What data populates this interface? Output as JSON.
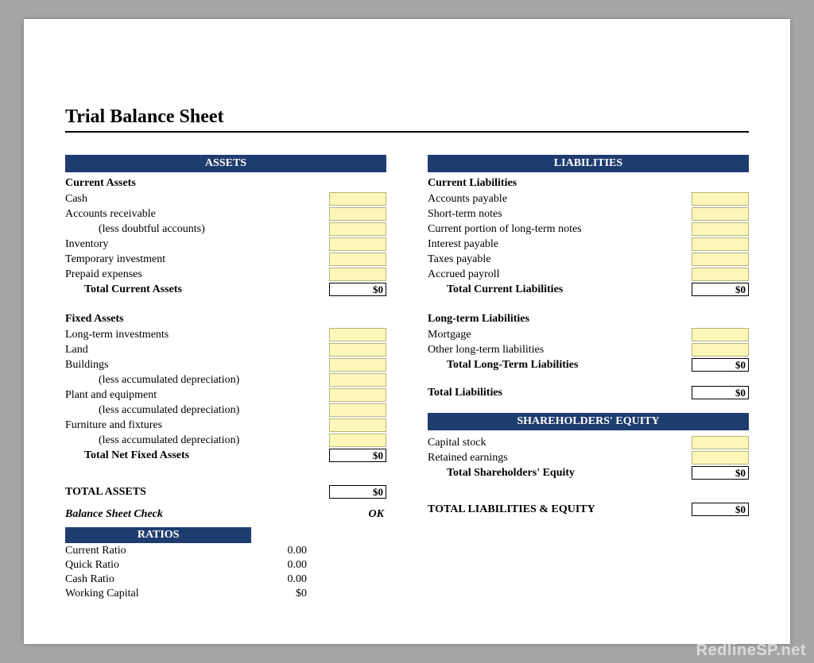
{
  "title": "Trial Balance Sheet",
  "watermark": "RedlineSP.net",
  "bands": {
    "assets": "ASSETS",
    "liabilities": "LIABILITIES",
    "equity": "SHAREHOLDERS' EQUITY",
    "ratios": "RATIOS"
  },
  "assets": {
    "current": {
      "heading": "Current Assets",
      "items": [
        {
          "label": "Cash"
        },
        {
          "label": "Accounts receivable"
        },
        {
          "label": "(less doubtful accounts)",
          "indent": true
        },
        {
          "label": "Inventory"
        },
        {
          "label": "Temporary investment"
        },
        {
          "label": "Prepaid expenses"
        }
      ],
      "total_label": "Total Current Assets",
      "total_value": "$0"
    },
    "fixed": {
      "heading": "Fixed Assets",
      "items": [
        {
          "label": "Long-term investments"
        },
        {
          "label": "Land"
        },
        {
          "label": "Buildings"
        },
        {
          "label": "(less accumulated depreciation)",
          "indent": true
        },
        {
          "label": "Plant and equipment"
        },
        {
          "label": "(less accumulated depreciation)",
          "indent": true
        },
        {
          "label": "Furniture and fixtures"
        },
        {
          "label": "(less accumulated depreciation)",
          "indent": true
        }
      ],
      "total_label": "Total Net Fixed Assets",
      "total_value": "$0"
    },
    "grand_label": "TOTAL ASSETS",
    "grand_value": "$0"
  },
  "liabilities": {
    "current": {
      "heading": "Current Liabilities",
      "items": [
        {
          "label": "Accounts payable"
        },
        {
          "label": "Short-term notes"
        },
        {
          "label": "Current portion of long-term notes"
        },
        {
          "label": "Interest payable"
        },
        {
          "label": "Taxes payable"
        },
        {
          "label": "Accrued payroll"
        }
      ],
      "total_label": "Total Current Liabilities",
      "total_value": "$0"
    },
    "longterm": {
      "heading": "Long-term Liabilities",
      "items": [
        {
          "label": "Mortgage"
        },
        {
          "label": "Other long-term liabilities"
        }
      ],
      "total_label": "Total Long-Term Liabilities",
      "total_value": "$0"
    },
    "total_label": "Total Liabilities",
    "total_value": "$0"
  },
  "equity": {
    "items": [
      {
        "label": "Capital stock"
      },
      {
        "label": "Retained earnings"
      }
    ],
    "total_label": "Total Shareholders' Equity",
    "total_value": "$0"
  },
  "right_grand_label": "TOTAL LIABILITIES & EQUITY",
  "right_grand_value": "$0",
  "check": {
    "label": "Balance Sheet Check",
    "value": "OK"
  },
  "ratios": {
    "items": [
      {
        "label": "Current Ratio",
        "value": "0.00"
      },
      {
        "label": "Quick Ratio",
        "value": "0.00"
      },
      {
        "label": "Cash Ratio",
        "value": "0.00"
      },
      {
        "label": "Working Capital",
        "value": "$0"
      }
    ]
  }
}
